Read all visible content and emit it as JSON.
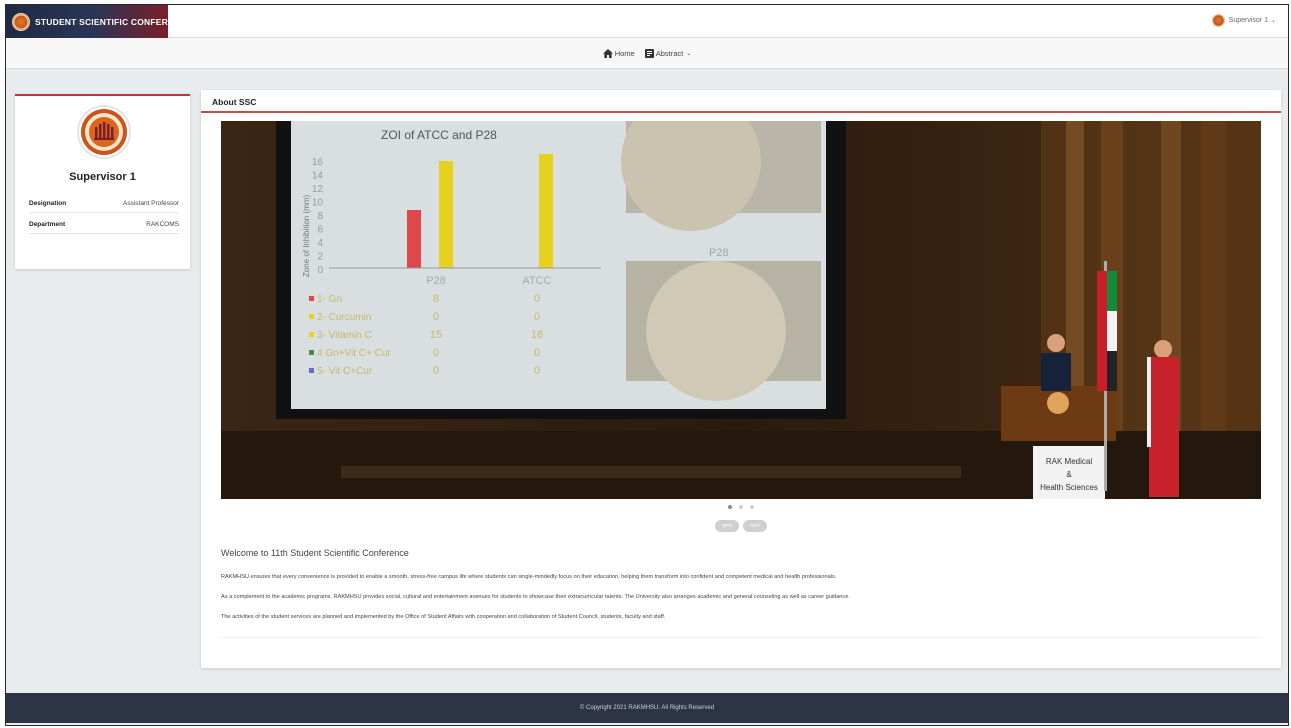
{
  "brand": {
    "title": "STUDENT SCIENTIFIC CONFERENCE"
  },
  "user_menu": {
    "name": "Supervisor 1"
  },
  "nav": {
    "home": "Home",
    "abstract": "Abstract"
  },
  "profile": {
    "name": "Supervisor 1",
    "rows": [
      {
        "key": "Designation",
        "value": "Assistant Professor"
      },
      {
        "key": "Department",
        "value": "RAKCOMS"
      }
    ]
  },
  "main": {
    "title": "About SSC",
    "carousel": {
      "prev_label": "prev",
      "next_label": "next",
      "slide_count": 3,
      "active_slide": 1
    },
    "welcome": "Welcome to 11th Student Scientific Conference",
    "paragraphs": [
      "RAKMHSU ensures that every convenience is provided to enable a smooth, stress-free campus life where students can single-mindedly focus on their education, helping them transform into confident and competent medical and health professionals.",
      "As a complement to the academic programs, RAKMHSU provides social, cultural and entertainment avenues for students to showcase their extracurricular talents. The University also arranges academic and general counseling as well as career guidance.",
      "The activities of the student services are planned and implemented by the Office of Student Affairs with cooperation and collaboration of Student Council, students, faculty and staff."
    ]
  },
  "slide": {
    "chart_title": "ZOI of ATCC and P28",
    "ylabel": "Zone of Inhibition (mm)",
    "yticks": [
      "16",
      "14",
      "12",
      "10",
      "8",
      "6",
      "4",
      "2",
      "0"
    ],
    "columns": [
      "P28",
      "ATCC"
    ],
    "table": [
      {
        "label": "1- Gn",
        "p28": "8",
        "atcc": "0"
      },
      {
        "label": "2- Curcumin",
        "p28": "0",
        "atcc": "0"
      },
      {
        "label": "3- Vitamin C",
        "p28": "15",
        "atcc": "16"
      },
      {
        "label": "4 Gn+Vit C+ Cur",
        "p28": "0",
        "atcc": "0"
      },
      {
        "label": "5- Vit C+Cur",
        "p28": "0",
        "atcc": "0"
      }
    ],
    "plate_label": "P28",
    "podium_sign": [
      "RAK Medical",
      "&",
      "Health Sciences"
    ]
  },
  "footer": {
    "text": "© Copyright 2021 RAKMHSU. All Rights Reserved"
  },
  "colors": {
    "brand_dark": "#1f2a44",
    "brand_red": "#7a1f2a",
    "accent_red": "#c84a4a",
    "footer_bg": "#2c3445",
    "bar_red": "#e0474c",
    "bar_yellow": "#e6d21e"
  }
}
